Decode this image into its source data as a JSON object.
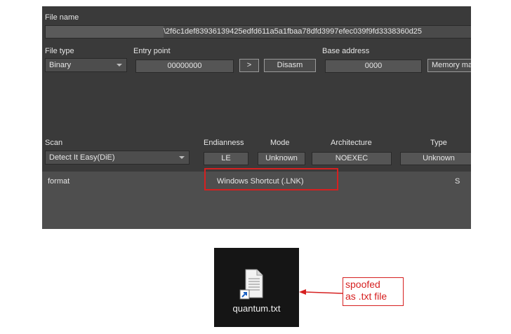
{
  "file_name": {
    "label": "File name",
    "value": "\\2f6c1def83936139425edfd611a5a1fbaa78dfd3997efec039f9fd3338360d25"
  },
  "file_type": {
    "label": "File type",
    "value": "Binary"
  },
  "entry_point": {
    "label": "Entry point",
    "value": "00000000",
    "next_label": ">",
    "disasm_label": "Disasm"
  },
  "base_address": {
    "label": "Base address",
    "value": "0000",
    "memory_map_label": "Memory ma"
  },
  "scan": {
    "label": "Scan",
    "value": "Detect It Easy(DiE)"
  },
  "endianness": {
    "label": "Endianness",
    "value": "LE"
  },
  "mode": {
    "label": "Mode",
    "value": "Unknown"
  },
  "architecture": {
    "label": "Architecture",
    "value": "NOEXEC"
  },
  "type": {
    "label": "Type",
    "value": "Unknown"
  },
  "result": {
    "key": "format",
    "value": "Windows Shortcut (.LNK)",
    "flag": "S"
  },
  "desktop_file": {
    "name": "quantum.txt",
    "icon": "text-file-shortcut-icon"
  },
  "annotation": {
    "line1": "spoofed",
    "line2": "as .txt file",
    "color": "#d62020"
  },
  "colors": {
    "panel_bg": "#3a3a3a",
    "field_bg": "#555555",
    "highlight": "#d62020",
    "explorer_bg": "#151515"
  }
}
